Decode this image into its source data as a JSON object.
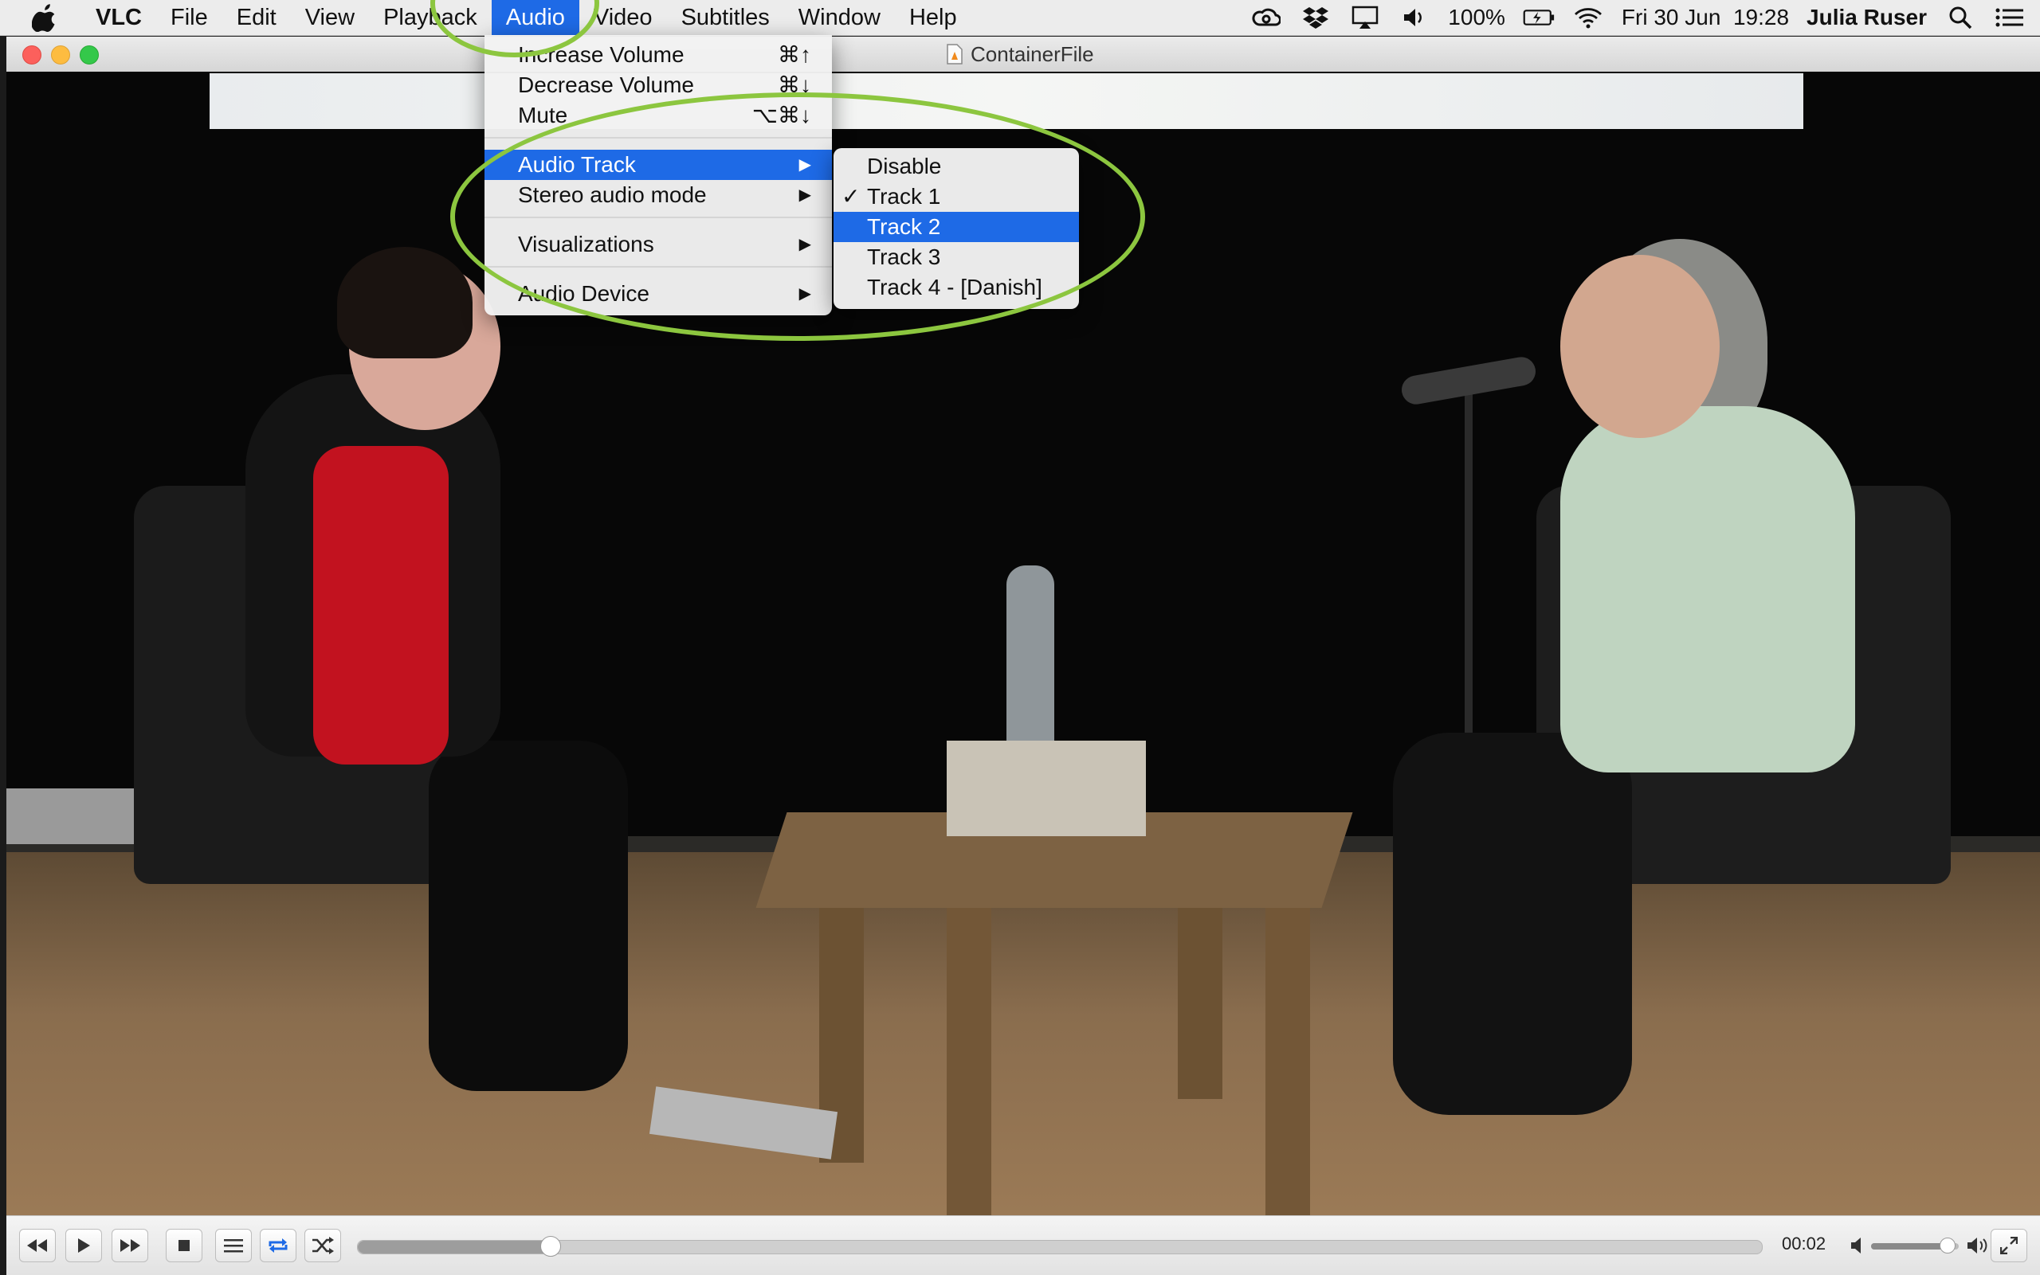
{
  "menubar": {
    "items": [
      "VLC",
      "File",
      "Edit",
      "View",
      "Playback",
      "Audio",
      "Video",
      "Subtitles",
      "Window",
      "Help"
    ],
    "battery": "100%",
    "datetime": "Fri 30 Jun  19:28",
    "user": "Julia Ruser",
    "icons": [
      "creative-cloud-icon",
      "dropbox-icon",
      "airplay-icon",
      "volume-icon",
      "battery-icon",
      "wifi-icon",
      "spotlight-search-icon",
      "notification-center-icon"
    ]
  },
  "window": {
    "title": "ContainerFile"
  },
  "audio_menu": {
    "increase_volume": {
      "label": "Increase Volume",
      "shortcut": "⌘↑"
    },
    "decrease_volume": {
      "label": "Decrease Volume",
      "shortcut": "⌘↓"
    },
    "mute": {
      "label": "Mute",
      "shortcut": "⌥⌘↓"
    },
    "audio_track": "Audio Track",
    "stereo_audio_mode": "Stereo audio mode",
    "visualizations": "Visualizations",
    "audio_device": "Audio Device"
  },
  "track_menu": {
    "disable": "Disable",
    "track1": "Track 1",
    "track2": "Track 2",
    "track3": "Track 3",
    "track4": "Track 4 - [Danish]",
    "checked": "Track 1",
    "highlighted": "Track 2"
  },
  "controls": {
    "elapsed": "00:02",
    "progress_fraction": 0.137,
    "volume_fraction": 0.86,
    "accent_color": "#1e6ae6"
  }
}
